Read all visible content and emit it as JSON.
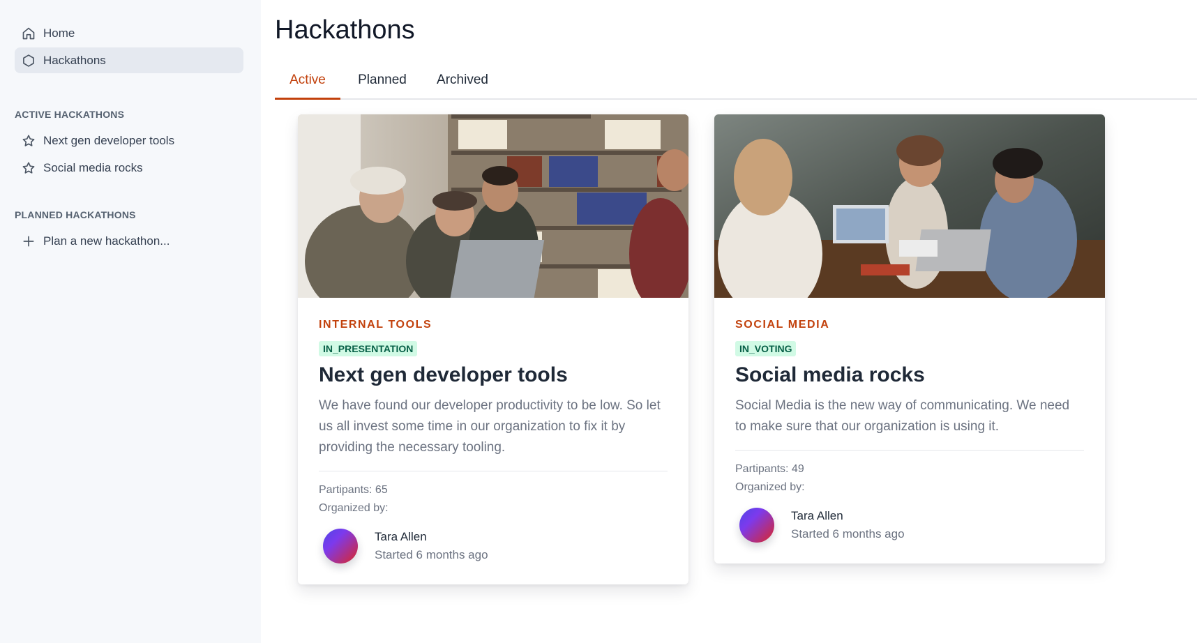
{
  "sidebar": {
    "nav": [
      {
        "label": "Home",
        "icon": "home-icon"
      },
      {
        "label": "Hackathons",
        "icon": "hexagon-icon",
        "active": true
      }
    ],
    "active_section_title": "ACTIVE HACKATHONS",
    "active_items": [
      {
        "label": "Next gen developer tools",
        "icon": "star-icon"
      },
      {
        "label": "Social media rocks",
        "icon": "star-icon"
      }
    ],
    "planned_section_title": "PLANNED HACKATHONS",
    "planned_items": [
      {
        "label": "Plan a new hackathon...",
        "icon": "plus-icon"
      }
    ]
  },
  "main": {
    "title": "Hackathons",
    "tabs": [
      {
        "label": "Active",
        "active": true
      },
      {
        "label": "Planned"
      },
      {
        "label": "Archived"
      }
    ],
    "cards": [
      {
        "category": "INTERNAL TOOLS",
        "status": "IN_PRESENTATION",
        "title": "Next gen developer tools",
        "description": "We have found our developer productivity to be low. So let us all invest some time in our organization to fix it by providing the necessary tooling.",
        "participants": "Partipants: 65",
        "organized_by": "Organized by:",
        "organizer_name": "Tara Allen",
        "started": "Started 6 months ago"
      },
      {
        "category": "SOCIAL MEDIA",
        "status": "IN_VOTING",
        "title": "Social media rocks",
        "description": "Social Media is the new way of communicating. We need to make sure that our organization is using it.",
        "participants": "Partipants: 49",
        "organized_by": "Organized by:",
        "organizer_name": "Tara Allen",
        "started": "Started 6 months ago"
      }
    ]
  },
  "colors": {
    "accent": "#c2410c",
    "badge_bg": "#d1fae5",
    "badge_text": "#065f46",
    "sidebar_bg": "#f6f8fb"
  }
}
